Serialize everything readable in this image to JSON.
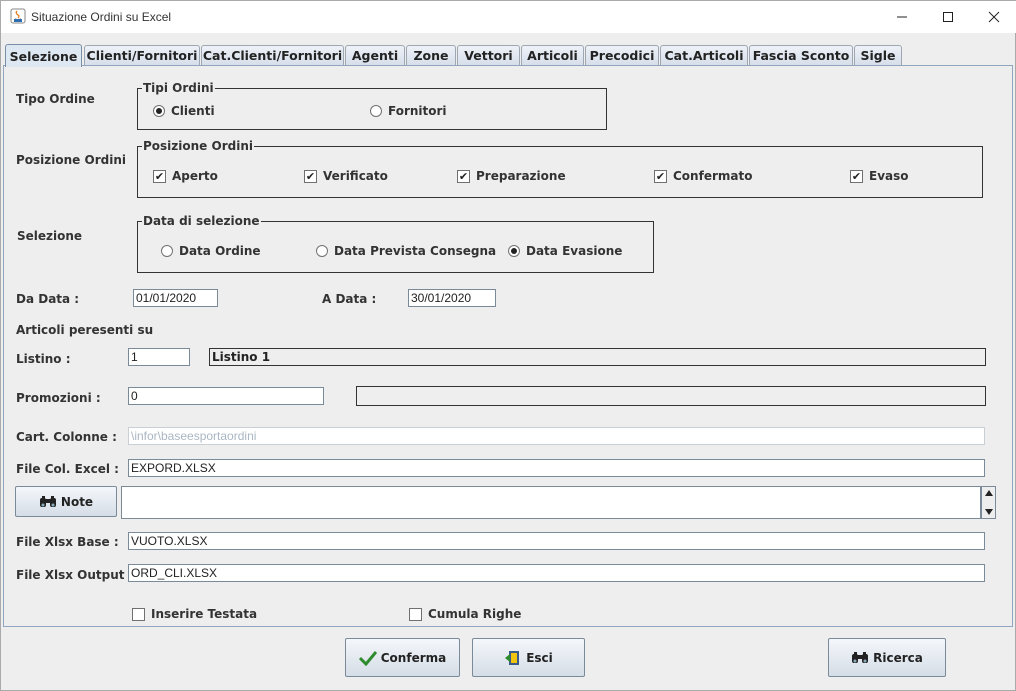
{
  "window": {
    "title": "Situazione Ordini su Excel"
  },
  "tabs": [
    {
      "label": "Selezione",
      "active": true
    },
    {
      "label": "Clienti/Fornitori"
    },
    {
      "label": "Cat.Clienti/Fornitori"
    },
    {
      "label": "Agenti"
    },
    {
      "label": "Zone"
    },
    {
      "label": "Vettori"
    },
    {
      "label": "Articoli"
    },
    {
      "label": "Precodici"
    },
    {
      "label": "Cat.Articoli"
    },
    {
      "label": "Fascia Sconto"
    },
    {
      "label": "Sigle"
    }
  ],
  "tipo_ordine": {
    "label": "Tipo Ordine",
    "group_title": "Tipi Ordini",
    "options": [
      {
        "label": "Clienti",
        "selected": true
      },
      {
        "label": "Fornitori",
        "selected": false
      }
    ]
  },
  "posizione_ordini": {
    "label": "Posizione Ordini",
    "group_title": "Posizione Ordini",
    "options": [
      {
        "label": "Aperto",
        "checked": true
      },
      {
        "label": "Verificato",
        "checked": true
      },
      {
        "label": "Preparazione",
        "checked": true
      },
      {
        "label": "Confermato",
        "checked": true
      },
      {
        "label": "Evaso",
        "checked": true
      }
    ]
  },
  "selezione": {
    "label": "Selezione",
    "group_title": "Data di selezione",
    "options": [
      {
        "label": "Data Ordine",
        "selected": false
      },
      {
        "label": "Data Prevista Consegna",
        "selected": false
      },
      {
        "label": "Data Evasione",
        "selected": true
      }
    ]
  },
  "date_range": {
    "from_label": "Da Data  :",
    "from_value": "01/01/2020",
    "to_label": "A   Data :",
    "to_value": "30/01/2020"
  },
  "articoli_heading": "Articoli peresenti su",
  "listino": {
    "label": "Listino :",
    "value": "1",
    "desc": "Listino 1"
  },
  "promozioni": {
    "label": "Promozioni :",
    "value": "0",
    "desc": ""
  },
  "cart_colonne": {
    "label": "Cart. Colonne :",
    "value": "\\infor\\baseesportaordini"
  },
  "file_col_excel": {
    "label": "File Col. Excel :",
    "value": "EXPORD.XLSX"
  },
  "note": {
    "button_label": "Note",
    "value": ""
  },
  "file_xlsx_base": {
    "label": "File Xlsx Base :",
    "value": "VUOTO.XLSX"
  },
  "file_xlsx_output": {
    "label": "File Xlsx Output :",
    "value": "ORD_CLI.XLSX"
  },
  "inserire_testata": {
    "label": "Inserire Testata",
    "checked": false
  },
  "cumula_righe": {
    "label": "Cumula Righe",
    "checked": false
  },
  "buttons": {
    "conferma": "Conferma",
    "esci": "Esci",
    "ricerca": "Ricerca"
  },
  "colors": {
    "tab_active": "#dde8f3",
    "panel_border": "#8fa6be",
    "disabled_text": "#a9b6c3"
  }
}
